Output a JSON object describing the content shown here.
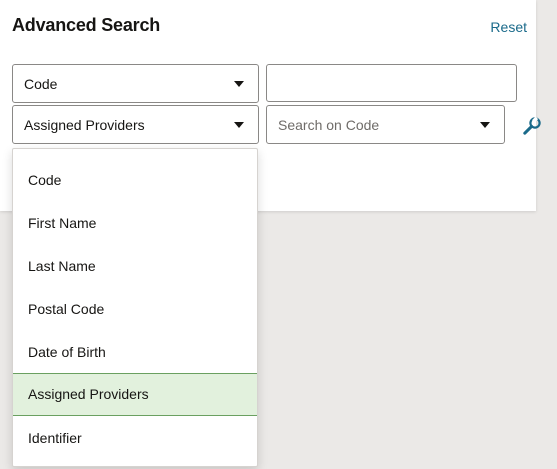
{
  "header": {
    "title": "Advanced Search",
    "reset_label": "Reset"
  },
  "row1": {
    "field_select_value": "Code",
    "text_input_value": ""
  },
  "row2": {
    "field_select_value": "Assigned Providers",
    "search_select_placeholder": "Search on Code"
  },
  "dropdown": {
    "items": [
      {
        "label": "Code",
        "selected": false
      },
      {
        "label": "First Name",
        "selected": false
      },
      {
        "label": "Last Name",
        "selected": false
      },
      {
        "label": "Postal Code",
        "selected": false
      },
      {
        "label": "Date of Birth",
        "selected": false
      },
      {
        "label": "Assigned Providers",
        "selected": true
      },
      {
        "label": "Identifier",
        "selected": false
      }
    ]
  },
  "icons": {
    "wrench": "wrench-icon",
    "caret": "chevron-down-icon"
  },
  "colors": {
    "accent_link": "#1a6a8a",
    "selected_bg": "#e2f1dd",
    "selected_border": "#6aa060"
  }
}
